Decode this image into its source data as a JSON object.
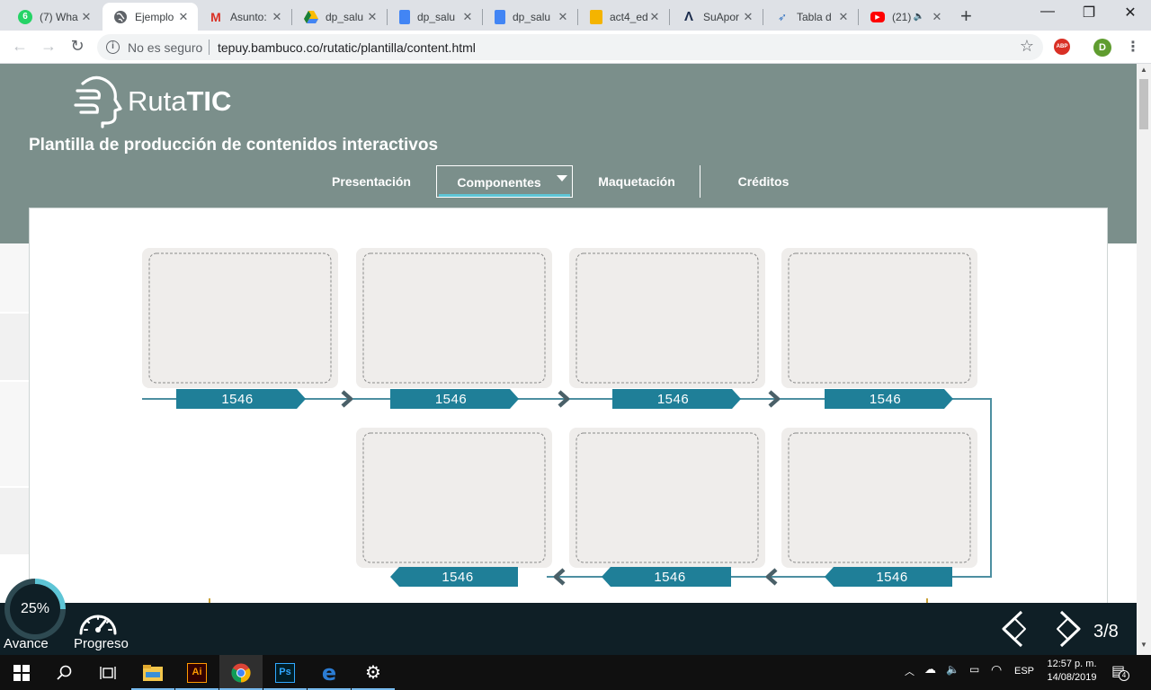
{
  "browser": {
    "tabs": [
      {
        "title": "(7) Wha",
        "favicon": "whatsapp-icon",
        "color": "#25d366",
        "badge": "6",
        "active": false
      },
      {
        "title": "Ejemplo",
        "favicon": "globe-icon",
        "color": "#5f6368",
        "badge": "",
        "active": true
      },
      {
        "title": "Asunto:",
        "favicon": "gmail-icon",
        "color": "#d93025",
        "badge": "M",
        "active": false
      },
      {
        "title": "dp_salu",
        "favicon": "drive-icon",
        "color": "#fbbc04",
        "badge": "",
        "active": false
      },
      {
        "title": "dp_salu",
        "favicon": "docs-icon",
        "color": "#4285f4",
        "badge": "",
        "active": false
      },
      {
        "title": "dp_salu",
        "favicon": "docs-icon",
        "color": "#4285f4",
        "badge": "",
        "active": false
      },
      {
        "title": "act4_ed",
        "favicon": "slides-icon",
        "color": "#f4b400",
        "badge": "",
        "active": false
      },
      {
        "title": "SuApor",
        "favicon": "suaporte-icon",
        "color": "#1a2b4c",
        "badge": "",
        "active": false
      },
      {
        "title": "Tabla d",
        "favicon": "bird-icon",
        "color": "#3b78c3",
        "badge": "",
        "active": false
      },
      {
        "title": "(21)",
        "favicon": "youtube-icon",
        "color": "#ff0000",
        "badge": "",
        "active": false,
        "audio": true
      }
    ],
    "security_text": "No es seguro",
    "url": "tepuy.bambuco.co/rutatic/plantilla/content.html",
    "abp_label": "ABP",
    "profile_initial": "D"
  },
  "site": {
    "logo_regular": "Ruta",
    "logo_bold": "TIC",
    "title": "Plantilla de producción de contenidos interactivos",
    "nav": [
      {
        "label": "Presentación",
        "active": false
      },
      {
        "label": "Componentes",
        "active": true,
        "has_dropdown": true
      },
      {
        "label": "Maquetación",
        "active": false
      },
      {
        "label": "Créditos",
        "active": false
      }
    ]
  },
  "timeline": {
    "accent_color": "#1f7f98",
    "line_color": "#4d8fa1",
    "row1": [
      {
        "label": "1546"
      },
      {
        "label": "1546"
      },
      {
        "label": "1546"
      },
      {
        "label": "1546"
      }
    ],
    "row2": [
      {
        "label": "1546"
      },
      {
        "label": "1546"
      },
      {
        "label": "1546"
      }
    ]
  },
  "footer": {
    "avance_value": "25%",
    "avance_fraction": 0.25,
    "avance_label": "Avance",
    "progreso_label": "Progreso",
    "page_counter": "3/8"
  },
  "taskbar": {
    "apps": [
      "file-explorer-icon",
      "illustrator-icon",
      "chrome-icon",
      "photoshop-icon",
      "edge-icon",
      "settings-icon"
    ],
    "language": "ESP",
    "time": "12:57 p. m.",
    "date": "14/08/2019",
    "notifications": "4"
  }
}
